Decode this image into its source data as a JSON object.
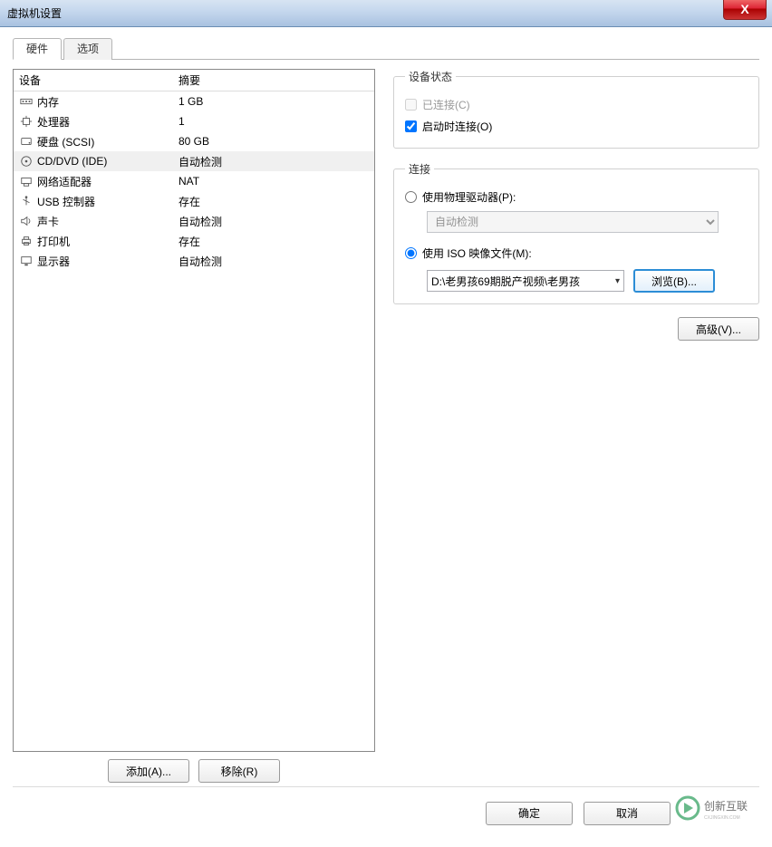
{
  "window": {
    "title": "虚拟机设置",
    "close_label": "X"
  },
  "tabs": [
    {
      "label": "硬件",
      "active": true
    },
    {
      "label": "选项",
      "active": false
    }
  ],
  "device_table": {
    "headers": {
      "device": "设备",
      "summary": "摘要"
    },
    "rows": [
      {
        "icon": "memory-icon",
        "device": "内存",
        "summary": "1 GB",
        "selected": false
      },
      {
        "icon": "cpu-icon",
        "device": "处理器",
        "summary": "1",
        "selected": false
      },
      {
        "icon": "disk-icon",
        "device": "硬盘 (SCSI)",
        "summary": "80 GB",
        "selected": false
      },
      {
        "icon": "cd-icon",
        "device": "CD/DVD (IDE)",
        "summary": "自动检测",
        "selected": true
      },
      {
        "icon": "nic-icon",
        "device": "网络适配器",
        "summary": "NAT",
        "selected": false
      },
      {
        "icon": "usb-icon",
        "device": "USB 控制器",
        "summary": "存在",
        "selected": false
      },
      {
        "icon": "sound-icon",
        "device": "声卡",
        "summary": "自动检测",
        "selected": false
      },
      {
        "icon": "printer-icon",
        "device": "打印机",
        "summary": "存在",
        "selected": false
      },
      {
        "icon": "display-icon",
        "device": "显示器",
        "summary": "自动检测",
        "selected": false
      }
    ],
    "add_label": "添加(A)...",
    "remove_label": "移除(R)"
  },
  "device_status": {
    "legend": "设备状态",
    "connected": {
      "label": "已连接(C)",
      "checked": false,
      "disabled": true
    },
    "connect_at_power": {
      "label": "启动时连接(O)",
      "checked": true,
      "disabled": false
    }
  },
  "connection": {
    "legend": "连接",
    "use_physical": {
      "label": "使用物理驱动器(P):",
      "selected": false,
      "dropdown_value": "自动检测"
    },
    "use_iso": {
      "label": "使用 ISO 映像文件(M):",
      "selected": true,
      "path": "D:\\老男孩69期脱产视频\\老男孩",
      "browse_label": "浏览(B)..."
    },
    "advanced_label": "高级(V)..."
  },
  "footer": {
    "ok": "确定",
    "cancel": "取消",
    "brand": "创新互联"
  }
}
